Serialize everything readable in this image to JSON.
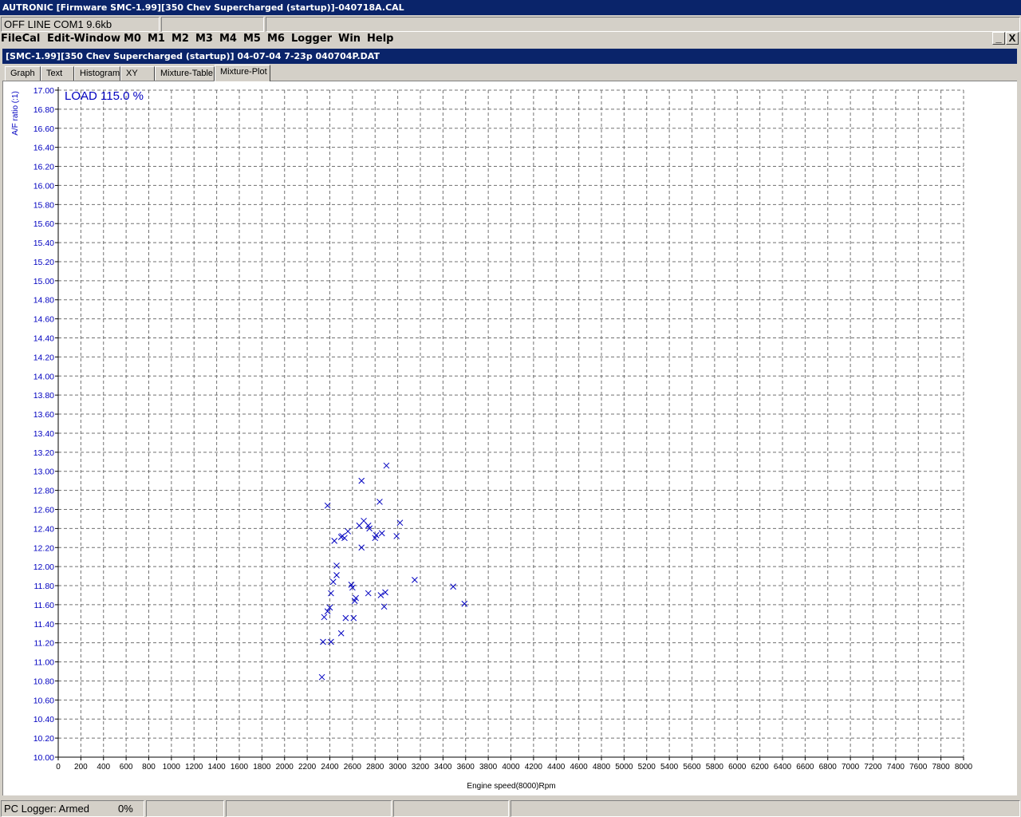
{
  "app": {
    "title": "AUTRONIC [Firmware SMC-1.99][350 Chev Supercharged (startup)]-040718A.CAL"
  },
  "status_top": {
    "connection": "OFF LINE COM1 9.6kb",
    "field2": "",
    "field3": ""
  },
  "menu": [
    "FileCal",
    "Edit-Window",
    "M0",
    "M1",
    "M2",
    "M3",
    "M4",
    "M5",
    "M6",
    "Logger",
    "Win",
    "Help"
  ],
  "window_controls": {
    "minimize": "_",
    "close": "X"
  },
  "child": {
    "title": "[SMC-1.99][350 Chev Supercharged (startup)] 04-07-04 7-23p 040704P.DAT"
  },
  "tabs": [
    {
      "label": "Graph",
      "active": false
    },
    {
      "label": "Text",
      "active": false
    },
    {
      "label": "Histogram",
      "active": false
    },
    {
      "label": "XY",
      "active": false
    },
    {
      "label": "Mixture-Table",
      "active": false
    },
    {
      "label": "Mixture-Plot",
      "active": true
    }
  ],
  "chart_data": {
    "type": "scatter",
    "annotation": "LOAD 115.0 %",
    "xlabel": "Engine speed(8000)Rpm",
    "ylabel": "A/F ratio (:1)",
    "xlim": [
      0,
      8000
    ],
    "ylim": [
      10.0,
      17.0
    ],
    "xticks": [
      0,
      200,
      400,
      600,
      800,
      1000,
      1200,
      1400,
      1600,
      1800,
      2000,
      2200,
      2400,
      2600,
      2800,
      3000,
      3200,
      3400,
      3600,
      3800,
      4000,
      4200,
      4400,
      4600,
      4800,
      5000,
      5200,
      5400,
      5600,
      5800,
      6000,
      6200,
      6400,
      6600,
      6800,
      7000,
      7200,
      7400,
      7600,
      7800,
      8000
    ],
    "yticks": [
      "10.00",
      "10.20",
      "10.40",
      "10.60",
      "10.80",
      "11.00",
      "11.20",
      "11.40",
      "11.60",
      "11.80",
      "12.00",
      "12.20",
      "12.40",
      "12.60",
      "12.80",
      "13.00",
      "13.20",
      "13.40",
      "13.60",
      "13.80",
      "14.00",
      "14.20",
      "14.40",
      "14.60",
      "14.80",
      "15.00",
      "15.20",
      "15.40",
      "15.60",
      "15.80",
      "16.00",
      "16.20",
      "16.40",
      "16.60",
      "16.80",
      "17.00"
    ],
    "grid": true,
    "marker": "x",
    "color": "#0000c0",
    "points": [
      [
        2380,
        12.64
      ],
      [
        2680,
        12.9
      ],
      [
        2900,
        13.06
      ],
      [
        2840,
        12.68
      ],
      [
        3020,
        12.46
      ],
      [
        2700,
        12.48
      ],
      [
        2660,
        12.43
      ],
      [
        2740,
        12.43
      ],
      [
        2750,
        12.4
      ],
      [
        2560,
        12.37
      ],
      [
        2510,
        12.32
      ],
      [
        2530,
        12.3
      ],
      [
        2500,
        12.31
      ],
      [
        2810,
        12.33
      ],
      [
        2800,
        12.3
      ],
      [
        2860,
        12.35
      ],
      [
        2990,
        12.32
      ],
      [
        2440,
        12.27
      ],
      [
        2680,
        12.2
      ],
      [
        2460,
        12.01
      ],
      [
        2460,
        11.91
      ],
      [
        2430,
        11.84
      ],
      [
        2590,
        11.81
      ],
      [
        2600,
        11.78
      ],
      [
        3150,
        11.86
      ],
      [
        2740,
        11.72
      ],
      [
        2890,
        11.73
      ],
      [
        2850,
        11.7
      ],
      [
        3490,
        11.79
      ],
      [
        2410,
        11.72
      ],
      [
        2630,
        11.67
      ],
      [
        2620,
        11.64
      ],
      [
        2400,
        11.57
      ],
      [
        2880,
        11.58
      ],
      [
        3590,
        11.61
      ],
      [
        2380,
        11.53
      ],
      [
        2350,
        11.47
      ],
      [
        2540,
        11.46
      ],
      [
        2610,
        11.46
      ],
      [
        2500,
        11.3
      ],
      [
        2340,
        11.21
      ],
      [
        2410,
        11.21
      ],
      [
        2330,
        10.84
      ]
    ]
  },
  "status_bottom": {
    "logger": "PC Logger: Armed",
    "percent": "0%",
    "field3": "",
    "field4": "",
    "field5": "",
    "field6": ""
  }
}
